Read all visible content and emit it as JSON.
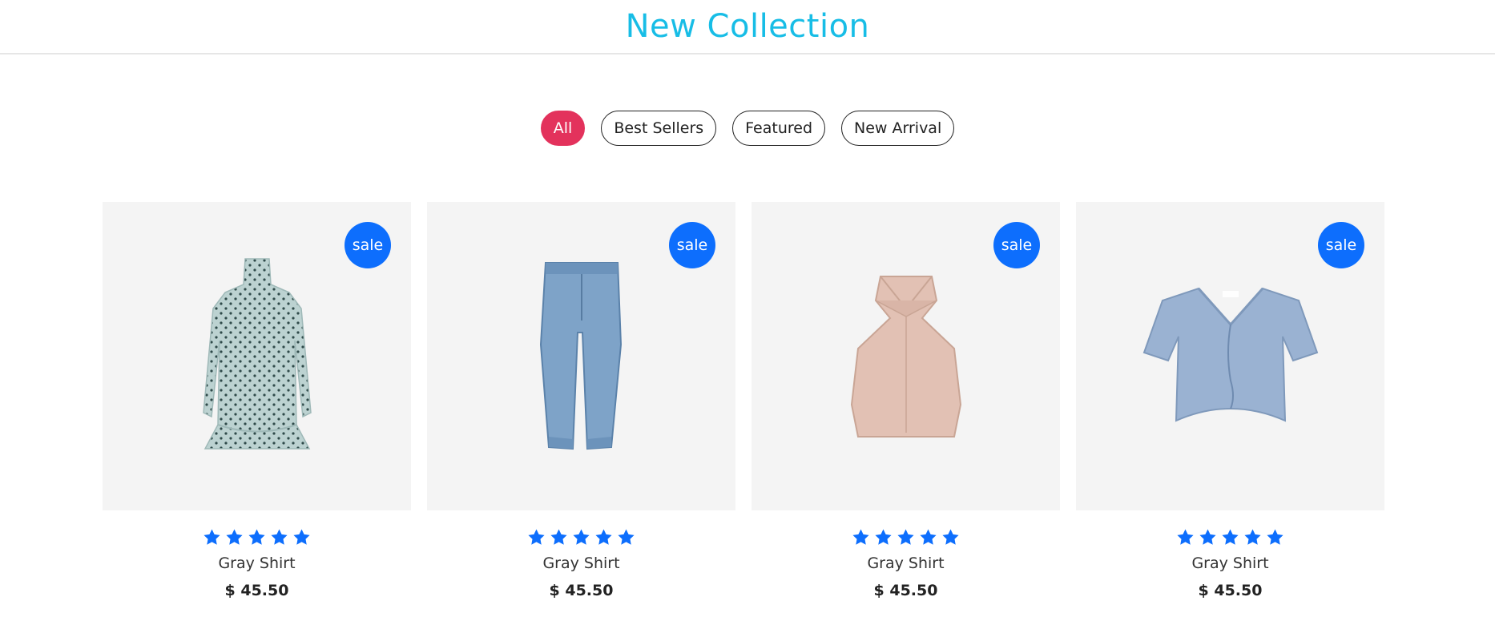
{
  "header": {
    "title": "New Collection"
  },
  "filters": [
    {
      "label": "All",
      "active": true
    },
    {
      "label": "Best Sellers",
      "active": false
    },
    {
      "label": "Featured",
      "active": false
    },
    {
      "label": "New Arrival",
      "active": false
    }
  ],
  "products": [
    {
      "badge": "sale",
      "rating": 5,
      "name": "Gray Shirt",
      "price": "$ 45.50",
      "image_icon": "polka-dot-dress-icon"
    },
    {
      "badge": "sale",
      "rating": 5,
      "name": "Gray Shirt",
      "price": "$ 45.50",
      "image_icon": "jeans-icon"
    },
    {
      "badge": "sale",
      "rating": 5,
      "name": "Gray Shirt",
      "price": "$ 45.50",
      "image_icon": "halter-top-icon"
    },
    {
      "badge": "sale",
      "rating": 5,
      "name": "Gray Shirt",
      "price": "$ 45.50",
      "image_icon": "crop-tshirt-icon"
    }
  ],
  "colors": {
    "title": "#17bde6",
    "active_filter": "#e3325c",
    "badge": "#0d6efd",
    "star": "#0d6efd"
  }
}
